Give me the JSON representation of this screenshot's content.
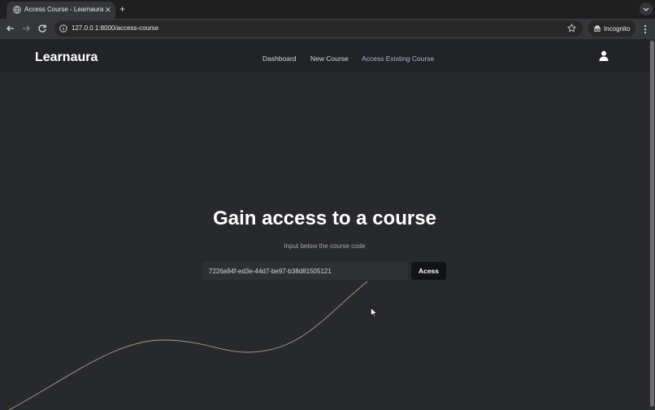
{
  "browser": {
    "tab_title": "Access Course - Learnaura",
    "tab_close": "✕",
    "new_tab": "+",
    "url": "127.0.0.1:8000/access-course",
    "incognito_label": "Incognito"
  },
  "header": {
    "brand": "Learnaura",
    "nav": [
      "Dashboard",
      "New Course",
      "Access Existing Course"
    ]
  },
  "main": {
    "title": "Gain access to a course",
    "subtitle": "Input below the course code",
    "course_code_value": "7226a94f-ed3e-44d7-be97-b38d81505121",
    "access_button": "Acess"
  },
  "colors": {
    "page_bg": "#28292d",
    "header_bg": "#222326",
    "accent_wave": "#b09a7e",
    "active_nav": "#a8b6d6"
  }
}
